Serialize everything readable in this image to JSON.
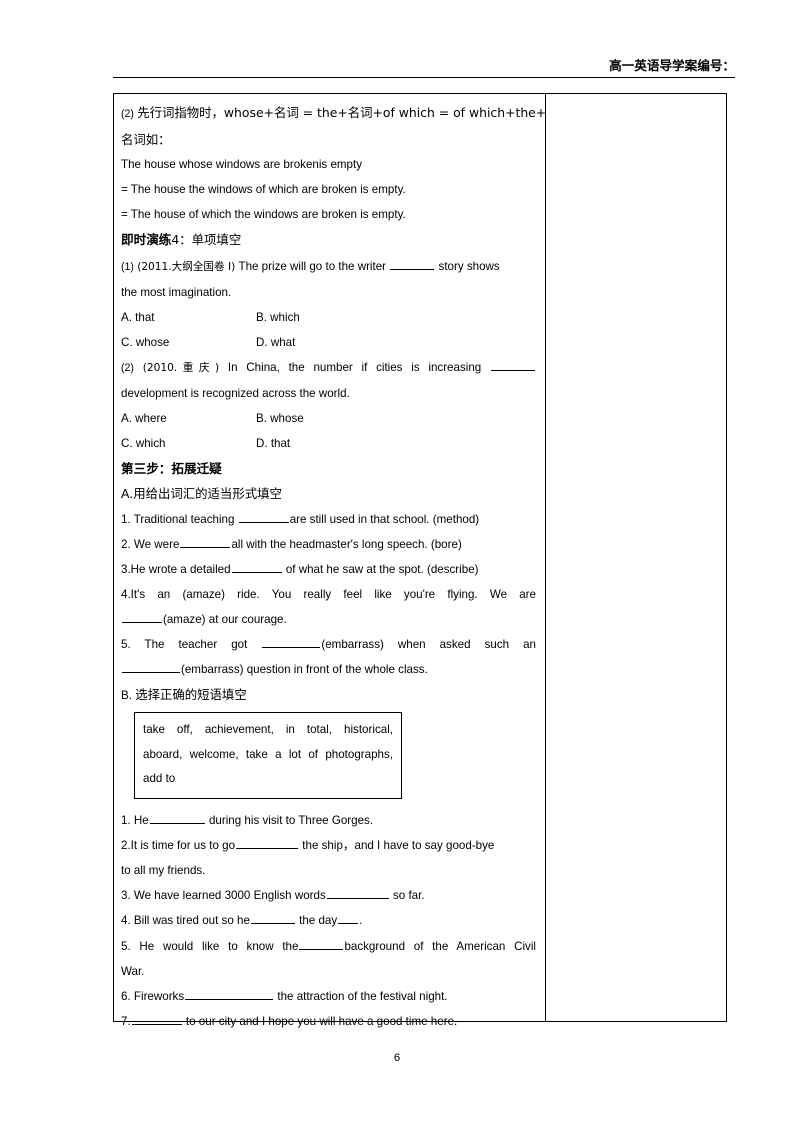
{
  "header": {
    "title": "高一英语导学案编号："
  },
  "content": {
    "grammar_note": {
      "line1_prefix": "(2)",
      "line1_text": "先行词指物时，whose+名词 = the+名词+of which = of which+the+",
      "line2_text": "名词如："
    },
    "examples": [
      "The house whose windows are brokenis empty",
      "= The house the windows of which are broken is empty.",
      "= The house of which the windows are broken is empty."
    ],
    "practice4": {
      "heading_bold": "即时演练",
      "heading_rest": "4：单项填空",
      "q1": {
        "num": "(1)",
        "source": "(2011.大纲全国卷 I)",
        "text_before": "The prize will go to the writer",
        "text_after": "story shows",
        "line2": "the most imagination.",
        "options": [
          {
            "key": "A. that",
            "key2": "B. which"
          },
          {
            "key": "C. whose",
            "key2": "D. what"
          }
        ]
      },
      "q2": {
        "num": "(2)",
        "source": "(2010.重庆)",
        "text_before": "In China, the number if cities is increasing",
        "line2": "development is recognized across the world.",
        "options": [
          {
            "key": "A. where",
            "key2": "B. whose"
          },
          {
            "key": "C. which",
            "key2": "D. that"
          }
        ]
      }
    },
    "step3": {
      "heading": "第三步：拓展迁疑",
      "section_a": {
        "title": "A.用给出词汇的适当形式填空",
        "items": [
          {
            "num": "1.",
            "t1": "Traditional teaching",
            "t2": "are still used in that school. (method)"
          },
          {
            "num": "2.",
            "t1": "We were",
            "t2": "all with the headmaster's long speech. (bore)"
          },
          {
            "num": "3.",
            "t1": "He wrote a detailed",
            "t2": "of what he saw at the spot. (describe)"
          },
          {
            "num": "4.",
            "t1": "It's an (amaze) ride. You really feel like you're flying. We are",
            "t2": "(amaze) at our courage."
          },
          {
            "num": "5.",
            "t1": "The teacher got",
            "t2": "(embarrass) when asked such an",
            "t3": "(embarrass) question in front of the whole class."
          }
        ]
      },
      "section_b": {
        "title_prefix": "B.",
        "title": "选择正确的短语填空",
        "wordbank": [
          "take off, achievement, in total, historical,",
          "aboard, welcome, take a lot of photographs,",
          "add to"
        ],
        "items": [
          {
            "num": "1.",
            "t1": "He",
            "t2": "during his visit to Three Gorges."
          },
          {
            "num": "2.",
            "t1": "It is time for us to go",
            "t2": "the ship，and I have to say good-bye",
            "t3": "to all my friends."
          },
          {
            "num": "3.",
            "t1": "We have learned 3000 English words",
            "t2": "so far."
          },
          {
            "num": "4.",
            "t1": "Bill was tired out so he",
            "t2": "the day",
            "t3": "."
          },
          {
            "num": "5.",
            "t1": "He would like to know the",
            "t2": "background of the American Civil",
            "t3": "War."
          },
          {
            "num": "6.",
            "t1": "Fireworks",
            "t2": "the attraction of the festival night."
          },
          {
            "num": "7.",
            "t1": "",
            "t2": "to our city and I hope you will have a good time here."
          }
        ]
      }
    }
  },
  "footer": {
    "page_number": "6"
  }
}
